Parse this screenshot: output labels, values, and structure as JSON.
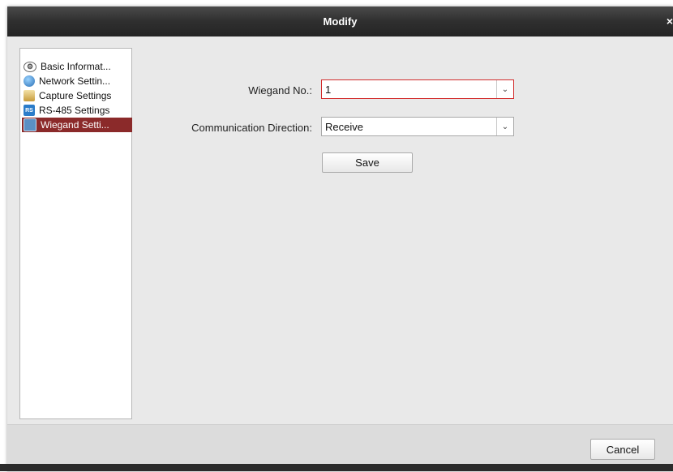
{
  "window": {
    "title": "Modify",
    "close_glyph": "×"
  },
  "sidebar": {
    "items": [
      {
        "label": "Basic Informat...",
        "icon": "info-icon",
        "selected": false
      },
      {
        "label": "Network Settin...",
        "icon": "network-icon",
        "selected": false
      },
      {
        "label": "Capture Settings",
        "icon": "capture-icon",
        "selected": false
      },
      {
        "label": "RS-485 Settings",
        "icon": "rs485-icon",
        "selected": false
      },
      {
        "label": "Wiegand Setti...",
        "icon": "wiegand-icon",
        "selected": true
      }
    ],
    "rs_icon_text": "RS"
  },
  "form": {
    "wiegand_no_label": "Wiegand No.:",
    "wiegand_no_value": "1",
    "direction_label": "Communication Direction:",
    "direction_value": "Receive",
    "save_label": "Save"
  },
  "footer": {
    "cancel_label": "Cancel"
  },
  "colors": {
    "selected_item": "#8b2a2a",
    "active_border": "#d22b2b",
    "titlebar": "#2f2f2f"
  }
}
